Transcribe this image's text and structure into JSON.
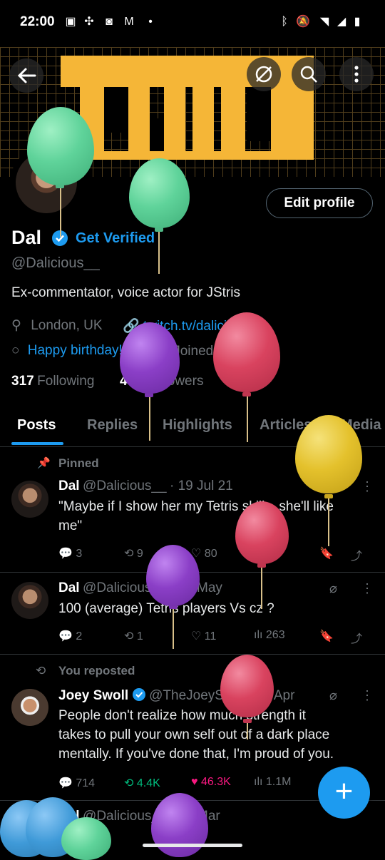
{
  "status_bar": {
    "time": "22:00"
  },
  "banner": {
    "text": "DAL"
  },
  "profile": {
    "name": "Dal",
    "get_verified": "Get Verified",
    "handle": "@Dalicious__",
    "bio": "Ex-commentator, voice actor for JStris",
    "location": "London, UK",
    "website": "twitch.tv/dalicious",
    "birthday": "Happy birthday!",
    "joined": "Joined June 2012",
    "following_count": "317",
    "following_label": "Following",
    "followers_count": "482",
    "followers_label": "Followers",
    "edit_profile": "Edit profile"
  },
  "tabs": [
    "Posts",
    "Replies",
    "Highlights",
    "Articles",
    "Media"
  ],
  "posts": [
    {
      "context": "Pinned",
      "author": "Dal",
      "handle": "@Dalicious__",
      "date": "· 19 Jul 21",
      "text_line1": "\"Maybe if I show her my Tetris skills, she'll like",
      "text_line2": "me\"",
      "replies": "3",
      "reposts": "9",
      "likes": "80",
      "views": ""
    },
    {
      "author": "Dal",
      "handle": "@Dalicious__",
      "date": "· 04 May",
      "text_line1": "100 (average) Tetris players Vs cz ?",
      "replies": "2",
      "reposts": "1",
      "likes": "11",
      "views": "263"
    },
    {
      "context": "You reposted",
      "author": "Joey Swoll",
      "handle": "@TheJoeySw...",
      "date": "· 28 Apr",
      "text_line1": "People don't realize how much strength it",
      "text_line2": "takes to pull your own self out of a dark place",
      "text_line3": "mentally. If you've done that, I'm proud of you.",
      "replies": "714",
      "reposts": "4.4K",
      "likes": "46.3K",
      "views": "1.1M"
    },
    {
      "author": "Dal",
      "handle": "@Dalicious__",
      "date": "· 08 Mar"
    }
  ],
  "fab": {
    "label": "+"
  },
  "colors": {
    "accent": "#1d9bf0",
    "banner_yellow": "#f5b637",
    "like_pink": "#f91880",
    "repost_green": "#00ba7c",
    "balloon_green": "#5fd39a",
    "balloon_purple": "#8b3fc7",
    "balloon_red": "#d9435f",
    "balloon_yellow": "#e4c12c"
  }
}
